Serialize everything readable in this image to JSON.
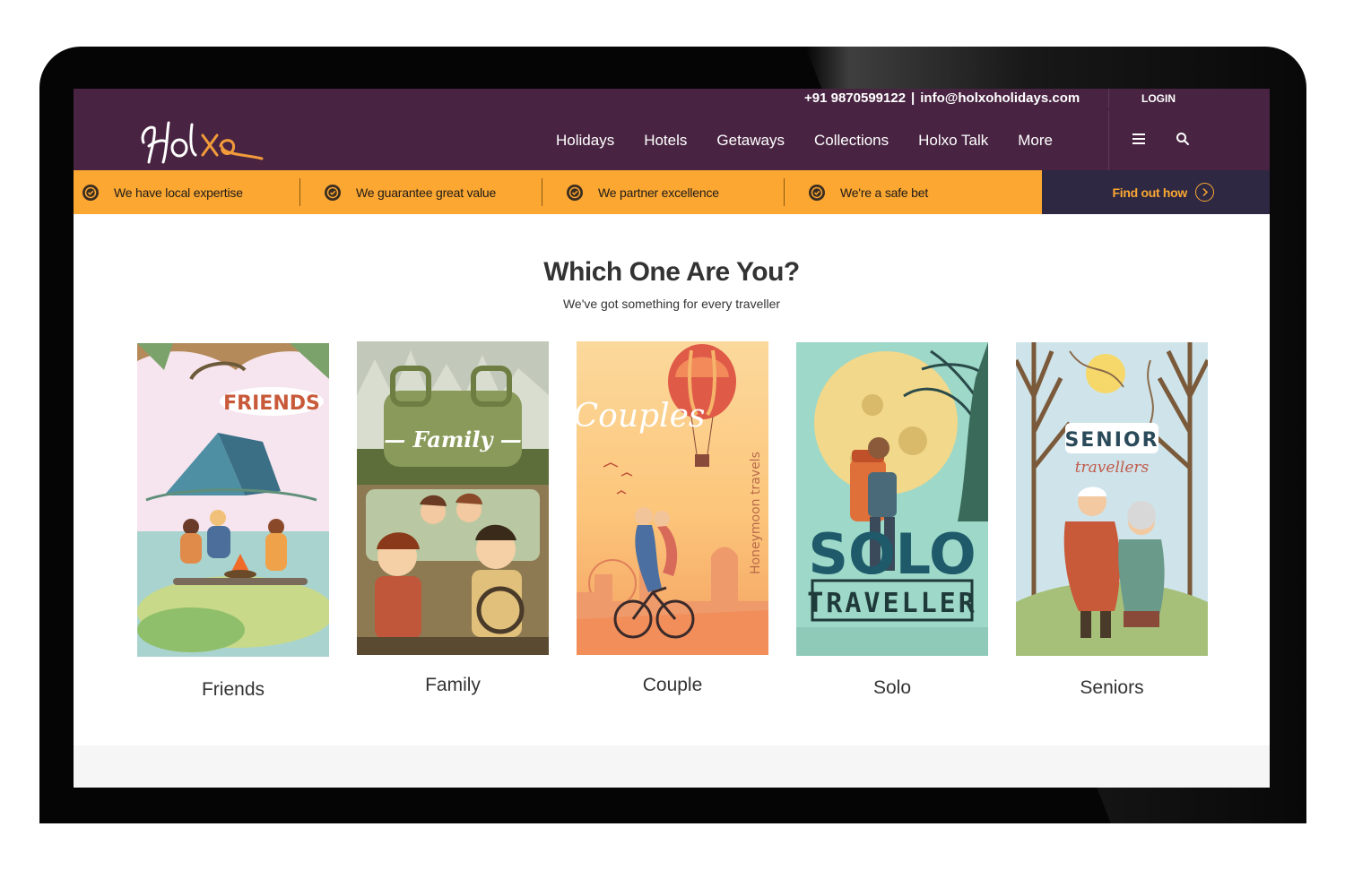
{
  "header": {
    "phone": "+91 9870599122",
    "separator": "|",
    "email": "info@holxoholidays.com",
    "login_label": "LOGIN",
    "logo_text": "Holxo",
    "nav": [
      "Holidays",
      "Hotels",
      "Getaways",
      "Collections",
      "Holxo Talk",
      "More"
    ],
    "brand_color": "#492442"
  },
  "usp_bar": {
    "items": [
      "We have local expertise",
      "We guarantee great value",
      "We partner excellence",
      "We're a safe bet"
    ],
    "cta_label": "Find out how",
    "bar_color": "#fba732",
    "cta_bg": "#2e2843"
  },
  "section": {
    "title": "Which One Are You?",
    "subtitle": "We've got something for every traveller"
  },
  "cards": [
    {
      "label": "Friends",
      "poster_text": "FRIENDS"
    },
    {
      "label": "Family",
      "poster_text": "— Family —"
    },
    {
      "label": "Couple",
      "poster_text": "Couples",
      "poster_sub": "Honeymoon travels"
    },
    {
      "label": "Solo",
      "poster_text": "SOLO",
      "poster_sub": "TRAVELLER"
    },
    {
      "label": "Seniors",
      "poster_text": "SENIOR",
      "poster_sub": "travellers"
    }
  ]
}
